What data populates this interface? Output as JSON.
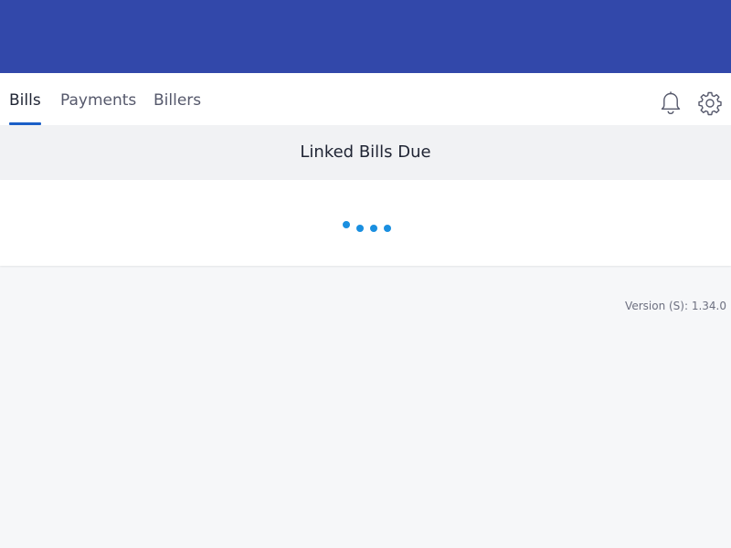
{
  "tabs": [
    {
      "label": "Bills",
      "active": true
    },
    {
      "label": "Payments",
      "active": false
    },
    {
      "label": "Billers",
      "active": false
    }
  ],
  "icons": {
    "notifications": "bell-icon",
    "settings": "gear-icon"
  },
  "section": {
    "title": "Linked Bills Due"
  },
  "loader": {
    "state": "loading",
    "color": "#1a8fe0"
  },
  "footer": {
    "version": "Version (S): 1.34.0"
  },
  "colors": {
    "header_bg": "#3248aa",
    "active_tab_underline": "#1b5fc7"
  }
}
